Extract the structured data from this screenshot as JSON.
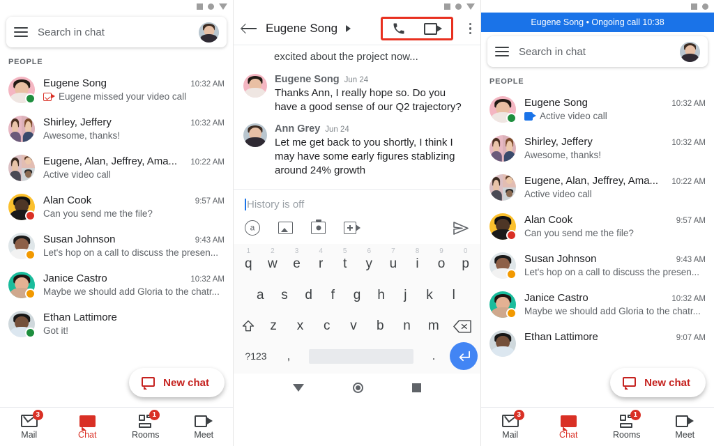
{
  "statusbar": {
    "icons": [
      "square-icon",
      "circle-icon",
      "triangle-down-icon"
    ]
  },
  "left_panel": {
    "search": {
      "placeholder": "Search in chat",
      "menu_icon": "hamburger-icon",
      "avatar": "user-avatar"
    },
    "section_label": "PEOPLE",
    "rows": [
      {
        "name": "Eugene Song",
        "time": "10:32 AM",
        "snippet": "Eugene missed your video call",
        "snippet_icon": "missed-video-call-icon",
        "presence": "online"
      },
      {
        "name": "Shirley, Jeffery",
        "time": "10:32 AM",
        "snippet": "Awesome, thanks!",
        "snippet_icon": "",
        "presence": ""
      },
      {
        "name": "Eugene, Alan, Jeffrey, Ama...",
        "time": "10:22 AM",
        "snippet": "Active video call",
        "snippet_icon": "",
        "presence": ""
      },
      {
        "name": "Alan Cook",
        "time": "9:57 AM",
        "snippet": "Can you send me the file?",
        "snippet_icon": "",
        "presence": "dnd"
      },
      {
        "name": "Susan Johnson",
        "time": "9:43 AM",
        "snippet": "Let's hop on a call to discuss the presen...",
        "snippet_icon": "",
        "presence": "away"
      },
      {
        "name": "Janice Castro",
        "time": "10:32 AM",
        "snippet": "Maybe we should add Gloria to the chatr...",
        "snippet_icon": "",
        "presence": "away"
      },
      {
        "name": "Ethan Lattimore",
        "time": "",
        "snippet": "Got it!",
        "snippet_icon": "",
        "presence": "online"
      }
    ],
    "fab": {
      "label": "New chat",
      "icon": "new-chat-icon"
    },
    "bottom_nav": [
      {
        "label": "Mail",
        "icon": "mail-icon",
        "badge": "3",
        "active": false
      },
      {
        "label": "Chat",
        "icon": "chat-icon",
        "badge": "",
        "active": true
      },
      {
        "label": "Rooms",
        "icon": "rooms-icon",
        "badge": "1",
        "active": false
      },
      {
        "label": "Meet",
        "icon": "meet-icon",
        "badge": "",
        "active": false
      }
    ]
  },
  "mid_panel": {
    "header": {
      "back_icon": "back-arrow-icon",
      "title": "Eugene Song",
      "caret_icon": "caret-right-icon",
      "phone_icon": "phone-call-icon",
      "video_icon": "video-call-icon",
      "overflow_icon": "more-vert-icon",
      "highlight_color": "#e8301f"
    },
    "partial_message": "excited about the project now...",
    "messages": [
      {
        "author": "Eugene Song",
        "date": "Jun 24",
        "text": "Thanks Ann, I really hope so. Do you have a good sense of our Q2 trajectory?"
      },
      {
        "author": "Ann Grey",
        "date": "Jun 24",
        "text": "Let me get back to you shortly, I think I may have some early figures stablizing around 24% growth"
      }
    ],
    "composer": {
      "placeholder": "History is off",
      "actions": [
        "mention-icon",
        "image-icon",
        "camera-icon",
        "add-video-icon"
      ],
      "send_icon": "send-icon"
    },
    "keyboard": {
      "row1": [
        {
          "k": "q",
          "n": "1"
        },
        {
          "k": "w",
          "n": "2"
        },
        {
          "k": "e",
          "n": "3"
        },
        {
          "k": "r",
          "n": "4"
        },
        {
          "k": "t",
          "n": "5"
        },
        {
          "k": "y",
          "n": "6"
        },
        {
          "k": "u",
          "n": "7"
        },
        {
          "k": "i",
          "n": "8"
        },
        {
          "k": "o",
          "n": "9"
        },
        {
          "k": "p",
          "n": "0"
        }
      ],
      "row2": [
        "a",
        "s",
        "d",
        "f",
        "g",
        "h",
        "j",
        "k",
        "l"
      ],
      "row3": [
        "z",
        "x",
        "c",
        "v",
        "b",
        "n",
        "m"
      ],
      "shift_icon": "shift-icon",
      "backspace_icon": "backspace-icon",
      "symbols_label": "?123",
      "comma_label": ",",
      "period_label": ".",
      "enter_icon": "enter-icon",
      "enter_color": "#4285f4"
    },
    "android_nav": [
      "back-nav-icon",
      "home-nav-icon",
      "recents-nav-icon"
    ]
  },
  "right_panel": {
    "call_banner": {
      "text": "Eugene Song • Ongoing call 10:38",
      "color": "#1a73e8"
    },
    "search": {
      "placeholder": "Search in chat",
      "menu_icon": "hamburger-icon",
      "avatar": "user-avatar"
    },
    "section_label": "PEOPLE",
    "rows": [
      {
        "name": "Eugene Song",
        "time": "10:32 AM",
        "snippet": "Active video call",
        "snippet_icon": "active-video-call-icon",
        "presence": "online"
      },
      {
        "name": "Shirley, Jeffery",
        "time": "10:32 AM",
        "snippet": "Awesome, thanks!",
        "snippet_icon": "",
        "presence": ""
      },
      {
        "name": "Eugene, Alan, Jeffrey, Ama...",
        "time": "10:22 AM",
        "snippet": "Active video call",
        "snippet_icon": "",
        "presence": ""
      },
      {
        "name": "Alan Cook",
        "time": "9:57 AM",
        "snippet": "Can you send me the file?",
        "snippet_icon": "",
        "presence": "dnd"
      },
      {
        "name": "Susan Johnson",
        "time": "9:43 AM",
        "snippet": "Let's hop on a call to discuss the presen...",
        "snippet_icon": "",
        "presence": "away"
      },
      {
        "name": "Janice Castro",
        "time": "10:32 AM",
        "snippet": "Maybe we should add Gloria to the chatr...",
        "snippet_icon": "",
        "presence": "away"
      },
      {
        "name": "Ethan Lattimore",
        "time": "9:07 AM",
        "snippet": "",
        "snippet_icon": "",
        "presence": ""
      }
    ],
    "fab": {
      "label": "New chat",
      "icon": "new-chat-icon"
    },
    "bottom_nav": [
      {
        "label": "Mail",
        "icon": "mail-icon",
        "badge": "3",
        "active": false
      },
      {
        "label": "Chat",
        "icon": "chat-icon",
        "badge": "",
        "active": true
      },
      {
        "label": "Rooms",
        "icon": "rooms-icon",
        "badge": "1",
        "active": false
      },
      {
        "label": "Meet",
        "icon": "meet-icon",
        "badge": "",
        "active": false
      }
    ]
  }
}
